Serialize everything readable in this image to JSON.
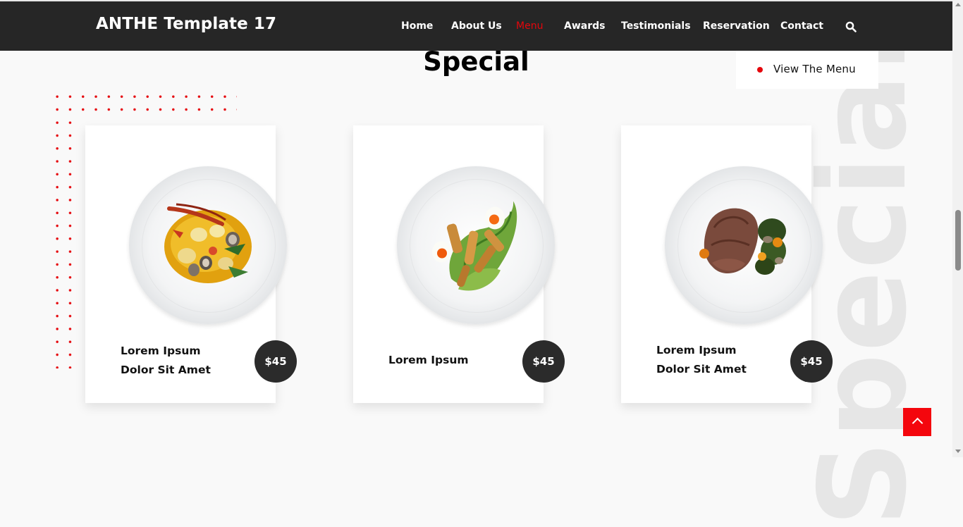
{
  "nav": {
    "brand": "ANTHE Template 17",
    "items": [
      {
        "label": "Home"
      },
      {
        "label": "About Us"
      },
      {
        "label": "Menu",
        "active": true
      },
      {
        "label": "Awards"
      },
      {
        "label": "Testimonials"
      },
      {
        "label": "Reservation"
      },
      {
        "label": "Contact"
      }
    ],
    "search_icon": "search-icon"
  },
  "section": {
    "title": "Special",
    "watermark": "Special",
    "view_menu_label": "View The Menu"
  },
  "cards": [
    {
      "name_line1": "Lorem Ipsum",
      "name_line2": "Dolor Sit Amet",
      "price": "$45",
      "dish": "seafood-stew"
    },
    {
      "name_line1": "Lorem Ipsum",
      "name_line2": "",
      "price": "$45",
      "dish": "chicken-caesar-salad"
    },
    {
      "name_line1": "Lorem Ipsum",
      "name_line2": "Dolor Sit Amet",
      "price": "$45",
      "dish": "steak-with-greens"
    }
  ],
  "back_to_top_icon": "chevron-up-icon",
  "colors": {
    "accent": "#e5060c",
    "navbar": "#262626",
    "price_badge": "#2b2b2b",
    "background": "#f9f9f9"
  }
}
